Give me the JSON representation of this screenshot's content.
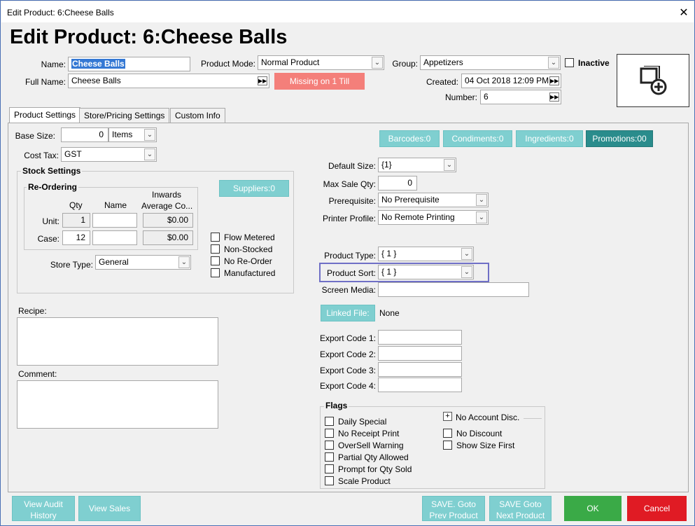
{
  "window": {
    "title": "Edit Product: 6:Cheese Balls"
  },
  "header": {
    "title": "Edit Product: 6:Cheese Balls"
  },
  "fields": {
    "name_label": "Name:",
    "name_value": "Cheese Balls",
    "fullname_label": "Full Name:",
    "fullname_value": "Cheese Balls",
    "mode_label": "Product Mode:",
    "mode_value": "Normal Product",
    "missing_label": "Missing on 1 Till",
    "group_label": "Group:",
    "group_value": "Appetizers",
    "inactive_label": "Inactive",
    "created_label": "Created:",
    "created_value": "04 Oct 2018 12:09 PM",
    "number_label": "Number:",
    "number_value": "6"
  },
  "tabs": [
    "Product Settings",
    "Store/Pricing Settings",
    "Custom Info"
  ],
  "left": {
    "base_size_label": "Base Size:",
    "base_size_value": "0",
    "base_unit": "Items",
    "cost_tax_label": "Cost Tax:",
    "cost_tax_value": "GST",
    "stock_settings": "Stock Settings",
    "reordering": "Re-Ordering",
    "col_qty": "Qty",
    "col_name": "Name",
    "col_inwards": "Inwards",
    "col_avg": "Average Co...",
    "unit_label": "Unit:",
    "unit_qty": "1",
    "unit_cost": "$0.00",
    "case_label": "Case:",
    "case_qty": "12",
    "case_cost": "$0.00",
    "suppliers_btn": "Suppliers:0",
    "flow_metered": "Flow Metered",
    "non_stocked": "Non-Stocked",
    "no_reorder": "No Re-Order",
    "manufactured": "Manufactured",
    "store_type_label": "Store Type:",
    "store_type_value": "General",
    "recipe_label": "Recipe:",
    "comment_label": "Comment:"
  },
  "right": {
    "barcodes_btn": "Barcodes:0",
    "condiments_btn": "Condiments:0",
    "ingredients_btn": "Ingredients:0",
    "promotions_btn": "Promotions:00",
    "default_size_label": "Default Size:",
    "default_size_value": "{1}",
    "max_sale_label": "Max Sale Qty:",
    "max_sale_value": "0",
    "prereq_label": "Prerequisite:",
    "prereq_value": "No Prerequisite",
    "printer_label": "Printer Profile:",
    "printer_value": "No Remote Printing",
    "ptype_label": "Product Type:",
    "ptype_value": "{ 1 }",
    "psort_label": "Product Sort:",
    "psort_value": "{ 1 }",
    "screen_media_label": "Screen Media:",
    "linked_file_btn": "Linked File:",
    "linked_file_value": "None",
    "export1": "Export Code 1:",
    "export2": "Export Code 2:",
    "export3": "Export Code 3:",
    "export4": "Export Code 4:",
    "flags_label": "Flags",
    "flags_left": [
      "Daily Special",
      "No Receipt Print",
      "OverSell Warning",
      "Partial Qty Allowed",
      "Prompt for Qty Sold",
      "Scale Product"
    ],
    "no_account_disc": "No Account Disc.",
    "no_discount": "No Discount",
    "show_size_first": "Show Size First"
  },
  "footer": {
    "audit": "View Audit\nHistory",
    "sales": "View Sales",
    "save_prev": "SAVE. Goto\nPrev Product",
    "save_next": "SAVE Goto\nNext Product",
    "ok": "OK",
    "cancel": "Cancel"
  },
  "colors": {
    "teal": "#7fcfd0",
    "teal_dark": "#2a8c8c",
    "ok": "#3aaa47",
    "cancel": "#e01b24",
    "missing": "#f47f7a",
    "highlight": "#6f6fc6"
  }
}
